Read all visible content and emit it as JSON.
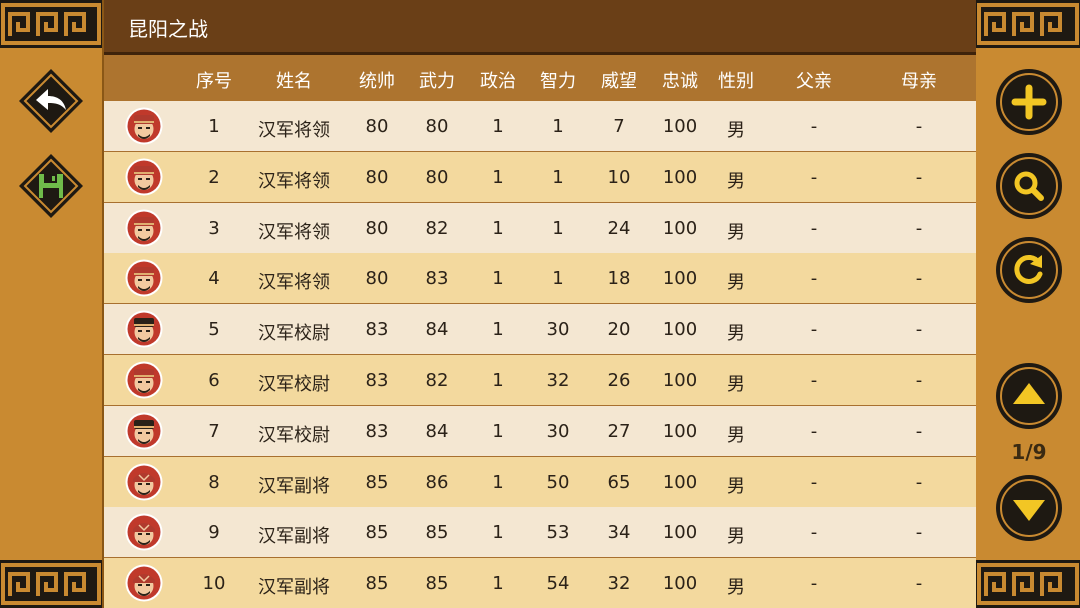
{
  "title": "昆阳之战",
  "columns": [
    "序号",
    "姓名",
    "统帅",
    "武力",
    "政治",
    "智力",
    "威望",
    "忠诚",
    "性别",
    "父亲",
    "母亲"
  ],
  "rows": [
    {
      "id": "1",
      "name": "汉军将领",
      "lead": "80",
      "war": "80",
      "pol": "1",
      "int": "1",
      "prestige": "7",
      "loyalty": "100",
      "gender": "男",
      "father": "-",
      "mother": "-",
      "avatar": "officer-portrait-red"
    },
    {
      "id": "2",
      "name": "汉军将领",
      "lead": "80",
      "war": "80",
      "pol": "1",
      "int": "1",
      "prestige": "10",
      "loyalty": "100",
      "gender": "男",
      "father": "-",
      "mother": "-",
      "avatar": "officer-portrait-red"
    },
    {
      "id": "3",
      "name": "汉军将领",
      "lead": "80",
      "war": "82",
      "pol": "1",
      "int": "1",
      "prestige": "24",
      "loyalty": "100",
      "gender": "男",
      "father": "-",
      "mother": "-",
      "avatar": "officer-portrait-red"
    },
    {
      "id": "4",
      "name": "汉军将领",
      "lead": "80",
      "war": "83",
      "pol": "1",
      "int": "1",
      "prestige": "18",
      "loyalty": "100",
      "gender": "男",
      "father": "-",
      "mother": "-",
      "avatar": "officer-portrait-red"
    },
    {
      "id": "5",
      "name": "汉军校尉",
      "lead": "83",
      "war": "84",
      "pol": "1",
      "int": "30",
      "prestige": "20",
      "loyalty": "100",
      "gender": "男",
      "father": "-",
      "mother": "-",
      "avatar": "officer-portrait-dark"
    },
    {
      "id": "6",
      "name": "汉军校尉",
      "lead": "83",
      "war": "82",
      "pol": "1",
      "int": "32",
      "prestige": "26",
      "loyalty": "100",
      "gender": "男",
      "father": "-",
      "mother": "-",
      "avatar": "officer-portrait-red"
    },
    {
      "id": "7",
      "name": "汉军校尉",
      "lead": "83",
      "war": "84",
      "pol": "1",
      "int": "30",
      "prestige": "27",
      "loyalty": "100",
      "gender": "男",
      "father": "-",
      "mother": "-",
      "avatar": "officer-portrait-dark"
    },
    {
      "id": "8",
      "name": "汉军副将",
      "lead": "85",
      "war": "86",
      "pol": "1",
      "int": "50",
      "prestige": "65",
      "loyalty": "100",
      "gender": "男",
      "father": "-",
      "mother": "-",
      "avatar": "officer-portrait-helmet"
    },
    {
      "id": "9",
      "name": "汉军副将",
      "lead": "85",
      "war": "85",
      "pol": "1",
      "int": "53",
      "prestige": "34",
      "loyalty": "100",
      "gender": "男",
      "father": "-",
      "mother": "-",
      "avatar": "officer-portrait-helmet"
    },
    {
      "id": "10",
      "name": "汉军副将",
      "lead": "85",
      "war": "85",
      "pol": "1",
      "int": "54",
      "prestige": "32",
      "loyalty": "100",
      "gender": "男",
      "father": "-",
      "mother": "-",
      "avatar": "officer-portrait-helmet"
    }
  ],
  "page_indicator": "1/9",
  "buttons": {
    "left": [
      "back-arrow-icon",
      "save-floppy-icon"
    ],
    "right": [
      "plus-icon",
      "search-icon",
      "refresh-icon",
      "arrow-up-icon",
      "arrow-down-icon"
    ]
  },
  "colors": {
    "row_light": "#f4e7d2",
    "row_gold": "#f3d99e",
    "header": "#ad742f",
    "titlebar": "#6a3f17",
    "frame": "#c98a31",
    "accent_green": "#6fbb4a"
  }
}
